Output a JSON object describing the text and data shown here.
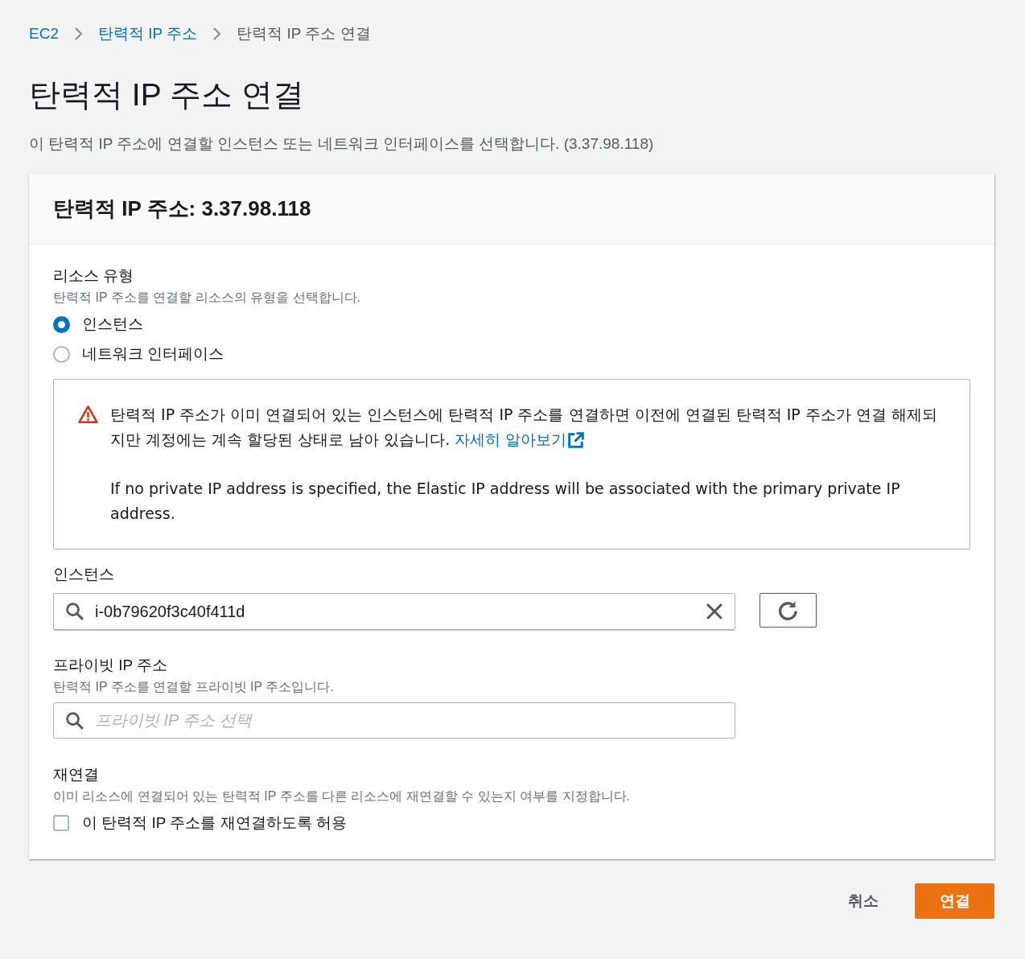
{
  "breadcrumb": [
    {
      "label": "EC2",
      "kind": "link"
    },
    {
      "label": "탄력적 IP 주소",
      "kind": "link"
    },
    {
      "label": "탄력적 IP 주소 연결",
      "kind": "current"
    }
  ],
  "page": {
    "title": "탄력적 IP 주소 연결",
    "description": "이 탄력적 IP 주소에 연결할 인스턴스 또는 네트워크 인터페이스를 선택합니다. (3.37.98.118)"
  },
  "panel": {
    "title": "탄력적 IP 주소: 3.37.98.118",
    "resource_type": {
      "label": "리소스 유형",
      "description": "탄력적 IP 주소를 연결할 리소스의 유형을 선택합니다.",
      "options": [
        {
          "label": "인스턴스",
          "selected": true
        },
        {
          "label": "네트워크 인터페이스",
          "selected": false
        }
      ]
    },
    "alert": {
      "kind": "warning",
      "paragraphs": [
        {
          "text": "탄력적 IP 주소가 이미 연결되어 있는 인스턴스에 탄력적 IP 주소를 연결하면 이전에 연결된 탄력적 IP 주소가 연결 해제되지만 계정에는 계속 할당된 상태로 남아 있습니다.",
          "link": "자세히 알아보기"
        },
        {
          "text": "If no private IP address is specified, the Elastic IP address will be associated with the primary private IP address."
        }
      ]
    },
    "instance": {
      "label": "인스턴스",
      "value": "i-0b79620f3c40f411d"
    },
    "private_ip": {
      "label": "프라이빗 IP 주소",
      "description": "탄력적 IP 주소를 연결할 프라이빗 IP 주소입니다.",
      "placeholder": "프라이빗 IP 주소 선택"
    },
    "reassociation": {
      "label": "재연결",
      "description": "이미 리소스에 연결되어 있는 탄력적 IP 주소를 다른 리소스에 재연결할 수 있는지 여부를 지정합니다.",
      "checkbox": {
        "label": "이 탄력적 IP 주소를 재연결하도록 허용",
        "checked": false
      }
    }
  },
  "buttons": [
    {
      "label": "취소",
      "kind": "link"
    },
    {
      "label": "연결",
      "kind": "primary"
    }
  ]
}
